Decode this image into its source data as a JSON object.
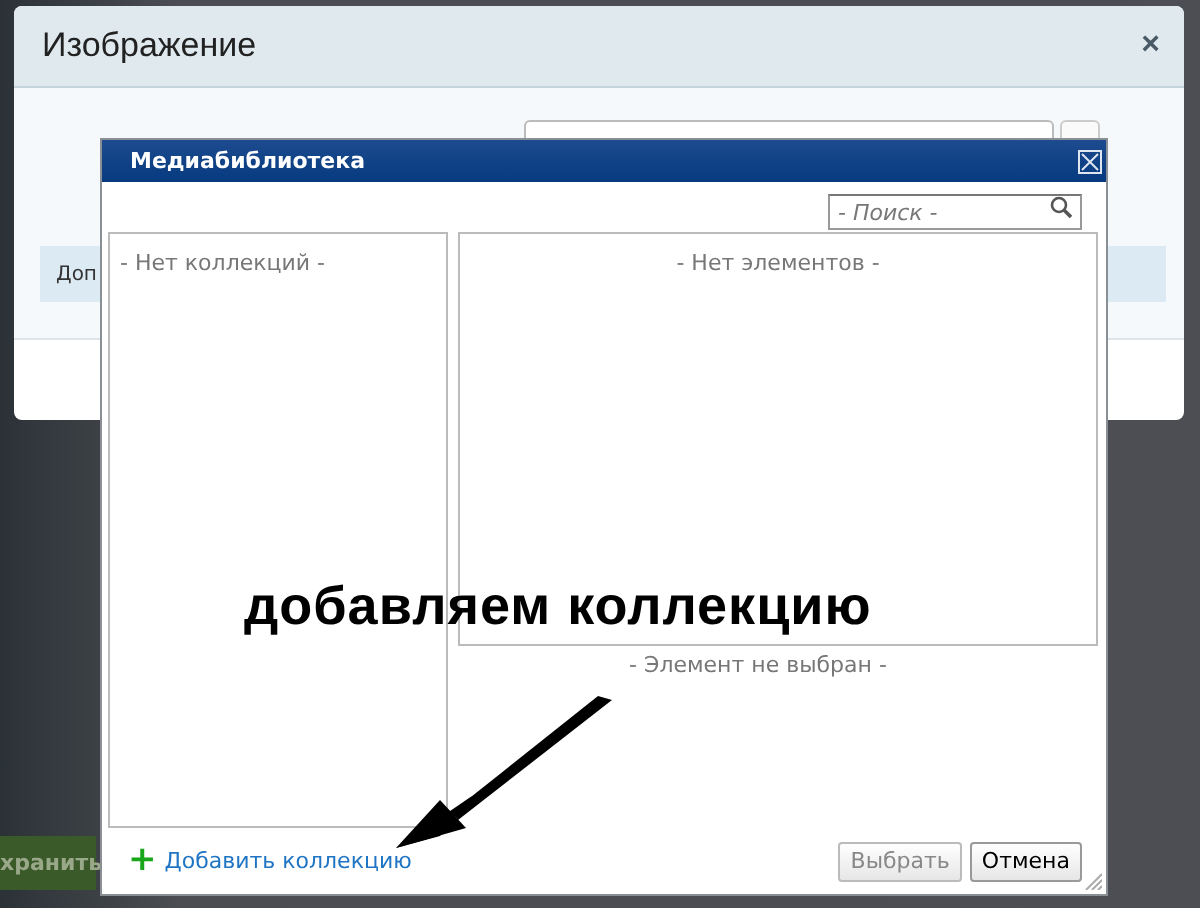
{
  "back_dialog": {
    "title": "Изображение",
    "close": "×",
    "info_strip": "Доп",
    "save_button": "хранить"
  },
  "media_library": {
    "title": "Медиабиблиотека",
    "search": {
      "placeholder": "- Поиск -"
    },
    "collections_empty": "- Нет коллекций -",
    "items_empty": "- Нет элементов -",
    "selection_empty": "- Элемент не выбран -",
    "add_collection": {
      "icon": "+",
      "label": "Добавить коллекцию"
    },
    "buttons": [
      {
        "label": "Выбрать",
        "disabled": true
      },
      {
        "label": "Отмена",
        "disabled": false
      }
    ]
  },
  "annotation": {
    "text": "добавляем коллекцию"
  }
}
